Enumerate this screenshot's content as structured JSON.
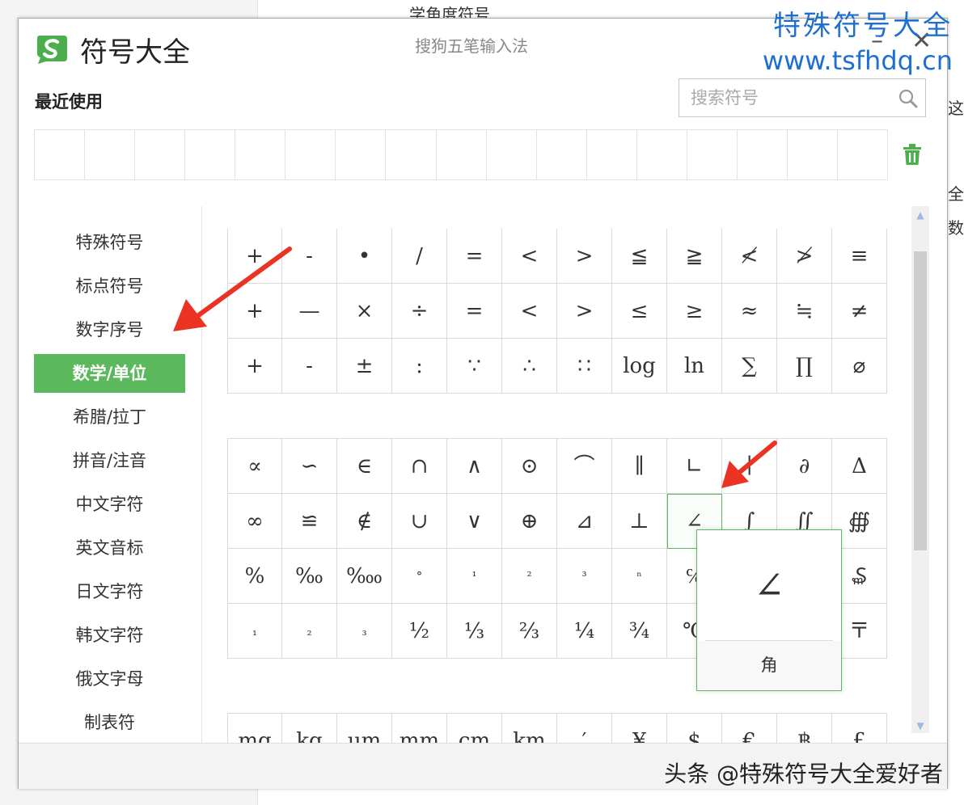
{
  "background": {
    "top_text": "学角度符号",
    "right_text": [
      "这",
      "全",
      "数"
    ]
  },
  "watermark": {
    "line1": "特殊符号大全",
    "line2": "www.tsfhdq.cn"
  },
  "window": {
    "title": "符号大全",
    "ime_name": "搜狗五笔输入法",
    "minimize_label": "–",
    "close_label": "✕",
    "brand_color": "#4cae4c"
  },
  "recent": {
    "label": "最近使用",
    "slots": 17
  },
  "search": {
    "placeholder": "搜索符号"
  },
  "sidebar": {
    "active_color": "#5cb85c",
    "items": [
      {
        "label": "特殊符号",
        "active": false
      },
      {
        "label": "标点符号",
        "active": false
      },
      {
        "label": "数字序号",
        "active": false
      },
      {
        "label": "数学/单位",
        "active": true
      },
      {
        "label": "希腊/拉丁",
        "active": false
      },
      {
        "label": "拼音/注音",
        "active": false
      },
      {
        "label": "中文字符",
        "active": false
      },
      {
        "label": "英文音标",
        "active": false
      },
      {
        "label": "日文字符",
        "active": false
      },
      {
        "label": "韩文字符",
        "active": false
      },
      {
        "label": "俄文字母",
        "active": false
      },
      {
        "label": "制表符",
        "active": false
      }
    ]
  },
  "symbol_groups": [
    {
      "rows": [
        [
          "+",
          "-",
          "•",
          "/",
          "=",
          "<",
          ">",
          "≦",
          "≧",
          "≮",
          "≯",
          "≡"
        ],
        [
          "+",
          "—",
          "×",
          "÷",
          "=",
          "<",
          ">",
          "≤",
          "≥",
          "≈",
          "≒",
          "≠"
        ],
        [
          "+",
          "-",
          "±",
          ":",
          "∵",
          "∴",
          "∷",
          "log",
          "ln",
          "∑",
          "∏",
          "⌀"
        ]
      ]
    },
    {
      "rows": [
        [
          "∝",
          "∽",
          "∈",
          "∩",
          "∧",
          "⊙",
          "⌒",
          "∥",
          "∟",
          "∣",
          "∂",
          "Δ"
        ],
        [
          "∞",
          "≌",
          "∉",
          "∪",
          "∨",
          "⊕",
          "⊿",
          "⊥",
          "∠",
          "∫",
          "∬",
          "∰"
        ],
        [
          "%",
          "‰",
          "‱",
          "°",
          "¹",
          "²",
          "³",
          "ⁿ",
          "℅",
          "",
          "",
          "₷"
        ],
        [
          "₁",
          "₂",
          "₃",
          "½",
          "⅓",
          "⅔",
          "¼",
          "¾",
          "℃",
          "",
          "",
          "〒"
        ]
      ]
    },
    {
      "rows": [
        [
          "mg",
          "kg",
          "μm",
          "mm",
          "cm",
          "km",
          "′",
          "¥",
          "$",
          "€",
          "฿",
          "£"
        ]
      ]
    }
  ],
  "popup": {
    "symbol": "∠",
    "name": "角"
  },
  "caption": "头条 @特殊符号大全爱好者"
}
